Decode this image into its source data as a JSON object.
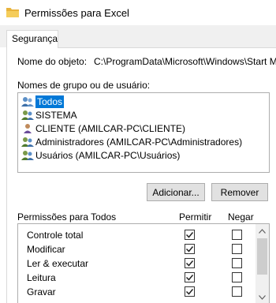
{
  "window": {
    "title": "Permissões para Excel"
  },
  "tabs": [
    {
      "label": "Segurança"
    }
  ],
  "object": {
    "label": "Nome do objeto:",
    "path": "C:\\ProgramData\\Microsoft\\Windows\\Start Men"
  },
  "groups": {
    "label": "Nomes de grupo ou de usuário:",
    "items": [
      {
        "name": "Todos",
        "icon": "users-group-icon",
        "selected": true
      },
      {
        "name": "SISTEMA",
        "icon": "users-group-icon",
        "selected": false
      },
      {
        "name": "CLIENTE (AMILCAR-PC\\CLIENTE)",
        "icon": "user-icon",
        "selected": false
      },
      {
        "name": "Administradores (AMILCAR-PC\\Administradores)",
        "icon": "users-group-icon",
        "selected": false
      },
      {
        "name": "Usuários (AMILCAR-PC\\Usuários)",
        "icon": "users-group-icon",
        "selected": false
      }
    ]
  },
  "buttons": {
    "add": "Adicionar...",
    "remove": "Remover"
  },
  "permissions": {
    "title": "Permissões para Todos",
    "col_allow": "Permitir",
    "col_deny": "Negar",
    "rows": [
      {
        "name": "Controle total",
        "allow": true,
        "deny": false
      },
      {
        "name": "Modificar",
        "allow": true,
        "deny": false
      },
      {
        "name": "Ler & executar",
        "allow": true,
        "deny": false
      },
      {
        "name": "Leitura",
        "allow": true,
        "deny": false
      },
      {
        "name": "Gravar",
        "allow": true,
        "deny": false
      }
    ]
  },
  "colors": {
    "selection": "#0078d7",
    "button_bg": "#e1e1e1",
    "folder": "#e8b33c"
  }
}
